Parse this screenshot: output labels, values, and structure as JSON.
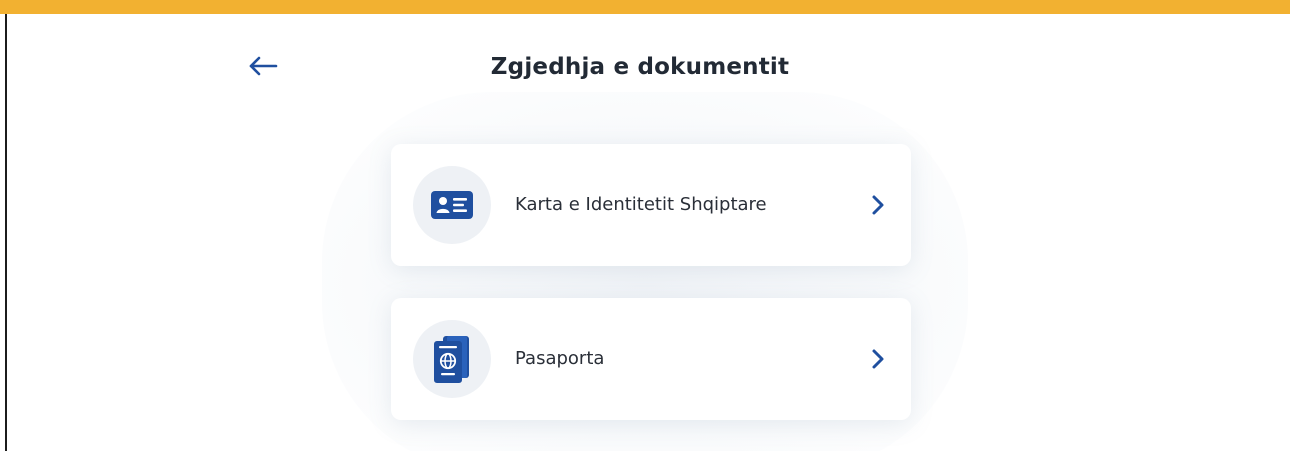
{
  "colors": {
    "accent_bar": "#f2b131",
    "primary_blue": "#1f4f9f",
    "icon_circle_bg": "#eef1f5",
    "title_text": "#222a35"
  },
  "header": {
    "back_icon": "arrow-left-icon",
    "title": "Zgjedhja e dokumentit"
  },
  "documents": [
    {
      "label": "Karta e Identitetit Shqiptare",
      "icon": "id-card-icon",
      "chevron_icon": "chevron-right-icon"
    },
    {
      "label": "Pasaporta",
      "icon": "passport-icon",
      "chevron_icon": "chevron-right-icon"
    }
  ]
}
